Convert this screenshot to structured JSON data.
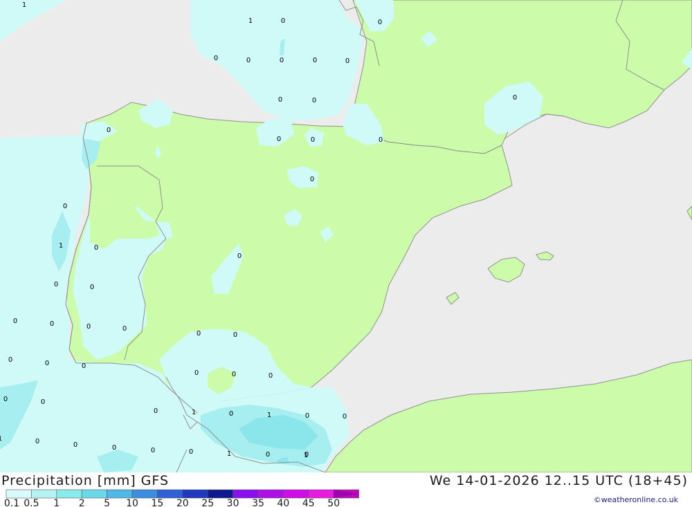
{
  "map": {
    "product": "Precipitation [mm] GFS",
    "valid_time": "We 14-01-2026 12..15 UTC (18+45)",
    "credit": "©weatheronline.co.uk",
    "colors": {
      "sea": "#ececec",
      "land_dry": "#ccfcaa",
      "precip_light": "#cffaf8",
      "precip_mid": "#a6eef0",
      "precip_heavy": "#8ae6ea",
      "coast": "#909090"
    },
    "values": [
      "1",
      "1",
      "0",
      "0",
      "0",
      "0",
      "0",
      "0",
      "0",
      "0",
      "0",
      "0",
      "0",
      "0",
      "0",
      "0",
      "0",
      "0",
      "0",
      "1",
      "0",
      "0",
      "0",
      "0",
      "0",
      "0",
      "0",
      "0",
      "0",
      "0",
      "0",
      "0",
      "0",
      "0",
      "0",
      "0",
      "0",
      "0",
      "1",
      "0",
      "0",
      "1",
      "0",
      "0",
      "1",
      "0",
      "0",
      "0",
      "0",
      "0",
      "1",
      "0",
      "1"
    ]
  },
  "legend": {
    "labels": [
      "0.1",
      "0.5",
      "1",
      "2",
      "5",
      "10",
      "15",
      "20",
      "25",
      "30",
      "35",
      "40",
      "45",
      "50"
    ],
    "colors": [
      "#d8fcfc",
      "#b6f4f4",
      "#88ecec",
      "#6ad8e8",
      "#50b8e8",
      "#3c8ce0",
      "#3060d8",
      "#2038c0",
      "#101890",
      "#8a10f0",
      "#b010e8",
      "#d00ce8",
      "#e81ce0",
      "#c008c0"
    ]
  }
}
